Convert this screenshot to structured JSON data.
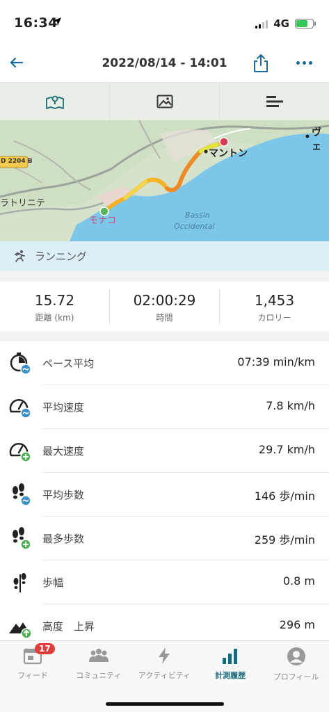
{
  "status": {
    "time": "16:34",
    "network": "4G"
  },
  "header": {
    "title": "2022/08/14 - 14:01"
  },
  "map": {
    "labels": {
      "menton": "マントン",
      "monaco": "モナコ",
      "bassin1": "Bassin",
      "bassin2": "Occidental",
      "roquebrune": "ラトリニテ",
      "road": "D 2204 B",
      "ve": "ヴェ"
    }
  },
  "activity": {
    "label": "ランニング"
  },
  "summary": [
    {
      "value": "15.72",
      "label": "距離 (km)"
    },
    {
      "value": "02:00:29",
      "label": "時間"
    },
    {
      "value": "1,453",
      "label": "カロリー"
    }
  ],
  "stats": [
    {
      "name": "ペース平均",
      "value": "07:39 min/km"
    },
    {
      "name": "平均速度",
      "value": "7.8 km/h"
    },
    {
      "name": "最大速度",
      "value": "29.7 km/h"
    },
    {
      "name": "平均歩数",
      "value": "146 歩/min"
    },
    {
      "name": "最多歩数",
      "value": "259 歩/min"
    },
    {
      "name": "歩幅",
      "value": "0.8 m"
    },
    {
      "name": "高度　上昇",
      "value": "296 m"
    }
  ],
  "tabbar": {
    "badge": "17",
    "items": [
      {
        "label": "フィード"
      },
      {
        "label": "コミュニティ"
      },
      {
        "label": "アクティビティ"
      },
      {
        "label": "計測履歴"
      },
      {
        "label": "プロフィール"
      }
    ]
  },
  "colors": {
    "accent": "#1a6b9a",
    "active_tab": "#1a6b7a",
    "badge": "#e23b3b",
    "sea": "#7cc6ea"
  }
}
